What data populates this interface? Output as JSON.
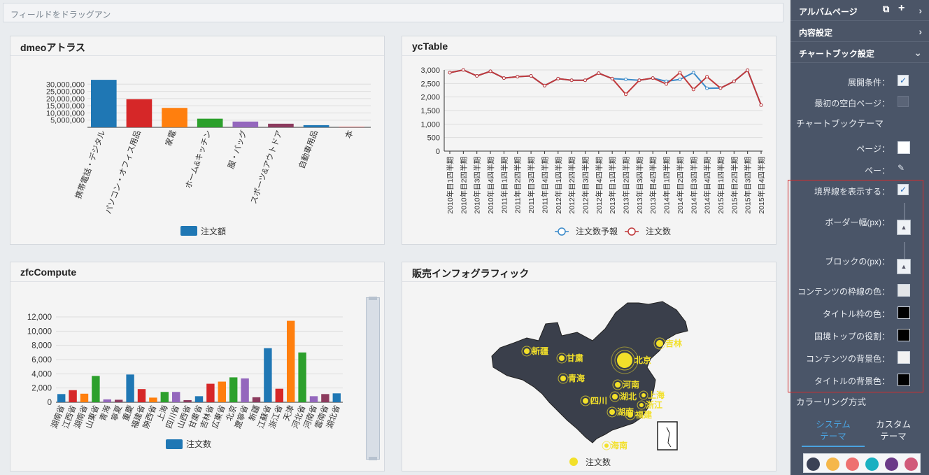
{
  "drop_bar": {
    "placeholder": "フィールドをドラッグアン"
  },
  "panels": {
    "dmeo": {
      "title": "dmeoアトラス"
    },
    "yctable": {
      "title": "ycTable"
    },
    "zfc": {
      "title": "zfcCompute"
    },
    "sales": {
      "title": "販売インフォグラフィック"
    }
  },
  "chart_data": [
    {
      "type": "bar",
      "categories": [
        "携帯電話・デジタル",
        "パソコン・オフィス用品",
        "家電",
        "ホーム&キッチン",
        "服・バッグ",
        "スポーツ&アウトドア",
        "自動車用品",
        "本"
      ],
      "values": [
        33000000,
        19500000,
        13500000,
        6000000,
        4000000,
        2500000,
        1500000,
        300000
      ],
      "series": [
        {
          "name": "注文額",
          "color": "#1f77b4"
        }
      ],
      "colors": [
        "#1f77b4",
        "#d62728",
        "#ff7f0e",
        "#2ca02c",
        "#9467bd",
        "#8c3b5e",
        "#1f77b4",
        "#d62728"
      ],
      "yticks": [
        "5,000,000",
        "10,000,000",
        "15,000,000",
        "20,000,000",
        "25,000,000",
        "30,000,000"
      ],
      "ylim": [
        0,
        35000000
      ]
    },
    {
      "type": "line",
      "categories": [
        "2010年目1四半期",
        "2010年目2四半期",
        "2010年目3四半期",
        "2010年目4四半期",
        "2011年目1四半期",
        "2011年目2四半期",
        "2011年目3四半期",
        "2011年目4四半期",
        "2012年目1四半期",
        "2012年目2四半期",
        "2012年目3四半期",
        "2012年目4四半期",
        "2013年目1四半期",
        "2013年目2四半期",
        "2013年目3四半期",
        "2013年目4四半期",
        "2014年目1四半期",
        "2014年目2四半期",
        "2014年目3四半期",
        "2014年目4四半期",
        "2015年目1四半期",
        "2015年目2四半期",
        "2015年目3四半期",
        "2015年目4四半期"
      ],
      "series": [
        {
          "name": "注文数予報",
          "color": "#3a8ac9",
          "values": [
            2900,
            3000,
            2780,
            2950,
            2700,
            2750,
            2780,
            2420,
            2680,
            2620,
            2620,
            2880,
            2680,
            2650,
            2620,
            2700,
            2580,
            2650,
            2900,
            2320,
            2330,
            2580,
            2990,
            1700
          ]
        },
        {
          "name": "注文数",
          "color": "#c0393b",
          "values": [
            2900,
            3000,
            2780,
            2950,
            2700,
            2750,
            2780,
            2420,
            2680,
            2620,
            2620,
            2880,
            2680,
            2100,
            2620,
            2700,
            2480,
            2900,
            2280,
            2750,
            2330,
            2580,
            2990,
            1700
          ]
        }
      ],
      "yticks": [
        "0",
        "500",
        "1,000",
        "1,500",
        "2,000",
        "2,500",
        "3,000"
      ],
      "ylim": [
        0,
        3000
      ]
    },
    {
      "type": "bar",
      "categories": [
        "湖南省",
        "江西省",
        "湖南省",
        "山東省",
        "青海",
        "寧夏",
        "重慶",
        "福建省",
        "陝西省",
        "上海",
        "四川省",
        "山西省",
        "甘粛省",
        "吉林省",
        "広東省",
        "北京",
        "遼寧省",
        "新疆",
        "江蘇省",
        "浙江省",
        "天津",
        "河北省",
        "河南省",
        "雲南省",
        "湖北省"
      ],
      "values": [
        1150,
        1700,
        1200,
        3700,
        400,
        350,
        3900,
        1850,
        650,
        1450,
        1450,
        300,
        850,
        2600,
        2900,
        3500,
        3350,
        700,
        7600,
        1900,
        11450,
        7000,
        850,
        1150,
        1250
      ],
      "series": [
        {
          "name": "注文数",
          "color": "#1f77b4"
        }
      ],
      "colors": [
        "#1f77b4",
        "#d62728",
        "#ff7f0e",
        "#2ca02c",
        "#9467bd",
        "#8c3b5e",
        "#1f77b4",
        "#d62728",
        "#ff7f0e",
        "#2ca02c",
        "#9467bd",
        "#8c3b5e",
        "#1f77b4",
        "#d62728",
        "#ff7f0e",
        "#2ca02c",
        "#9467bd",
        "#8c3b5e",
        "#1f77b4",
        "#d62728",
        "#ff7f0e",
        "#2ca02c",
        "#9467bd",
        "#8c3b5e",
        "#1f77b4"
      ],
      "yticks": [
        "0",
        "2,000",
        "4,000",
        "6,000",
        "8,000",
        "10,000",
        "12,000"
      ],
      "ylim": [
        0,
        12000
      ]
    }
  ],
  "map": {
    "legend": "注文数",
    "labels": [
      "新疆",
      "甘粛",
      "青海",
      "吉林",
      "北京",
      "河南",
      "四川",
      "湖北",
      "上海",
      "浙江",
      "海南",
      "福建",
      "湖南"
    ]
  },
  "sidebar": {
    "album": "アルバムページ",
    "content": "内容設定",
    "chartbook": "チャートブック設定",
    "expand_label": "展開条件：",
    "first_blank_label": "最初の空白ページ：",
    "theme_section": "チャートブックテーマ",
    "page_label": "ページ：",
    "bg_label": "ペー：",
    "show_border_label": "境界線を表示する：",
    "border_width_label": "ボーダー幅(px)：",
    "block_label": "ブロックの(px)：",
    "content_border_color_label": "コンテンツの枠線の色：",
    "title_border_color_label": "タイトル枠の色：",
    "border_top_label": "国境トップの役割：",
    "content_bg_label": "コンテンツの背景色：",
    "title_bg_label": "タイトルの背景色：",
    "coloring_section": "カラーリング方式",
    "tab_system": "システム\nテーマ",
    "tab_custom": "カスタム\nテーマ",
    "palette": [
      "#3b4256",
      "#f5b74a",
      "#ee7070",
      "#1ab0c1",
      "#6b3a88",
      "#d15a7a"
    ]
  }
}
